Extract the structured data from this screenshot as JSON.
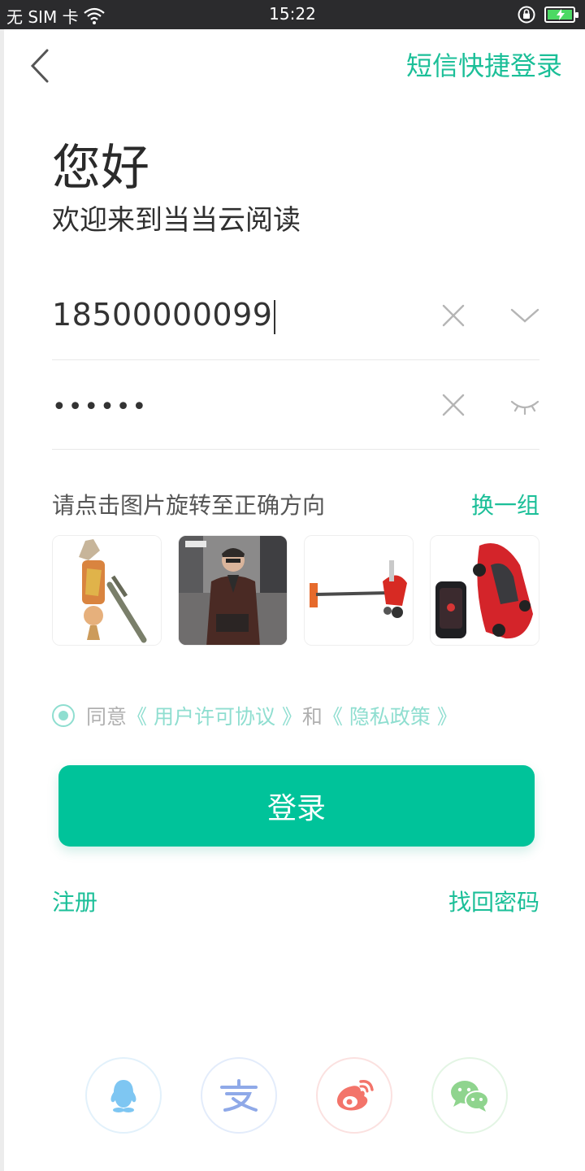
{
  "status_bar": {
    "carrier": "无 SIM 卡",
    "time": "15:22"
  },
  "header": {
    "sms_login": "短信快捷登录"
  },
  "greeting": {
    "title": "您好",
    "subtitle": "欢迎来到当当云阅读"
  },
  "form": {
    "phone_value": "18500000099",
    "password_mask": "••••••"
  },
  "captcha": {
    "hint": "请点击图片旋转至正确方向",
    "refresh": "换一组"
  },
  "agreement": {
    "prefix": "同意",
    "user_license": "《 用户许可协议 》",
    "and": "和",
    "privacy": "《 隐私政策 》"
  },
  "actions": {
    "login": "登录",
    "register": "注册",
    "forgot_password": "找回密码"
  },
  "colors": {
    "accent": "#1bbf98",
    "button": "#00c39a",
    "status_bar": "#2b2b2d"
  },
  "social": [
    "qq-icon",
    "alipay-icon",
    "weibo-icon",
    "wechat-icon"
  ]
}
